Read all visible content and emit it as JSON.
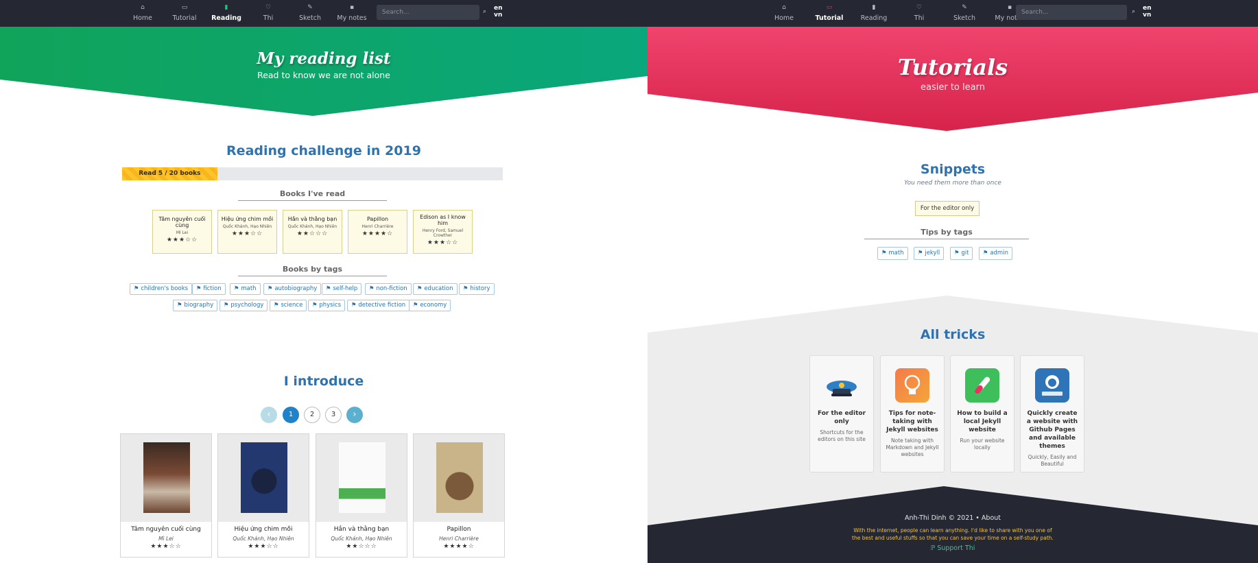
{
  "left": {
    "nav": {
      "items": [
        {
          "label": "Home",
          "icon": "home-icon"
        },
        {
          "label": "Tutorial",
          "icon": "book-open-icon"
        },
        {
          "label": "Reading",
          "icon": "book-icon"
        },
        {
          "label": "Thi",
          "icon": "heart-icon"
        },
        {
          "label": "Sketch",
          "icon": "pencil-icon"
        },
        {
          "label": "My notes",
          "icon": "note-icon"
        }
      ],
      "active": "Reading",
      "search_placeholder": "Search...",
      "lang_en": "en",
      "lang_vn": "vn"
    },
    "hero": {
      "title": "My reading list",
      "subtitle": "Read to know we are not alone",
      "color": "#0ea56a"
    },
    "challenge": {
      "title": "Reading challenge in 2019",
      "progress_label": "Read 5 / 20 books",
      "read": 5,
      "total": 20
    },
    "books_read_title": "Books I've read",
    "books_read": [
      {
        "title": "Tâm nguyên cuối cùng",
        "author": "Mì Lei",
        "rating": 3
      },
      {
        "title": "Hiệu ứng chim mồi",
        "author": "Quốc Khánh, Hạo Nhiên",
        "rating": 3
      },
      {
        "title": "Hắn và thằng bạn",
        "author": "Quốc Khánh, Hạo Nhiên",
        "rating": 2
      },
      {
        "title": "Papillon",
        "author": "Henri Charrière",
        "rating": 4
      },
      {
        "title": "Edison as I know him",
        "author": "Henry Ford, Samuel Crowther",
        "rating": 3
      }
    ],
    "tags_title": "Books by tags",
    "tags": [
      "children's books",
      "fiction",
      "math",
      "autobiography",
      "self-help",
      "non-fiction",
      "education",
      "history",
      "biography",
      "psychology",
      "science",
      "physics",
      "detective fiction",
      "economy"
    ],
    "introduce": {
      "title": "I introduce",
      "pages": [
        "1",
        "2",
        "3"
      ],
      "current_page": "1",
      "prev": "‹",
      "next": "›",
      "cards": [
        {
          "title": "Tâm nguyên cuối cùng",
          "author": "Mì Lei",
          "rating": 3
        },
        {
          "title": "Hiệu ứng chim mồi",
          "author": "Quốc Khánh, Hạo Nhiên",
          "rating": 3
        },
        {
          "title": "Hắn và thằng bạn",
          "author": "Quốc Khánh, Hạo Nhiên",
          "rating": 2
        },
        {
          "title": "Papillon",
          "author": "Henri Charrière",
          "rating": 4
        }
      ]
    }
  },
  "right": {
    "nav": {
      "items": [
        {
          "label": "Home",
          "icon": "home-icon"
        },
        {
          "label": "Tutorial",
          "icon": "book-open-icon"
        },
        {
          "label": "Reading",
          "icon": "book-icon"
        },
        {
          "label": "Thi",
          "icon": "heart-icon"
        },
        {
          "label": "Sketch",
          "icon": "pencil-icon"
        },
        {
          "label": "My notes",
          "icon": "note-icon"
        }
      ],
      "active": "Tutorial",
      "search_placeholder": "Search...",
      "lang_en": "en",
      "lang_vn": "vn"
    },
    "hero": {
      "title": "Tutorials",
      "subtitle": "easier to learn",
      "color": "#e63462"
    },
    "snippets": {
      "title": "Snippets",
      "subtitle": "You need them more than once",
      "editor_button": "For the editor only"
    },
    "tips_title": "Tips by tags",
    "tips_tags": [
      "math",
      "jekyll",
      "git",
      "admin"
    ],
    "all_tricks": {
      "title": "All tricks",
      "cards": [
        {
          "title": "For the editor only",
          "desc": "Shortcuts for the editors on this site",
          "icon": "police-hat-icon"
        },
        {
          "title": "Tips for note-taking with Jekyll websites",
          "desc": "Note taking with Markdown and Jekyll websites",
          "icon": "lightbulb-icon"
        },
        {
          "title": "How to build a local Jekyll website",
          "desc": "Run your website locally",
          "icon": "test-tube-icon"
        },
        {
          "title": "Quickly create a website with Github Pages and available themes",
          "desc": "Quickly, Easily and Beautiful",
          "icon": "github-pages-icon"
        }
      ]
    },
    "footer": {
      "line": "Anh-Thi Dinh  ©  2021  •  About",
      "message1": "With the internet, people can learn anything. I'd like to share with you one of",
      "message2": "the best and useful stuffs so that you can save your time on a self-study path.",
      "support": "Support Thi"
    }
  }
}
